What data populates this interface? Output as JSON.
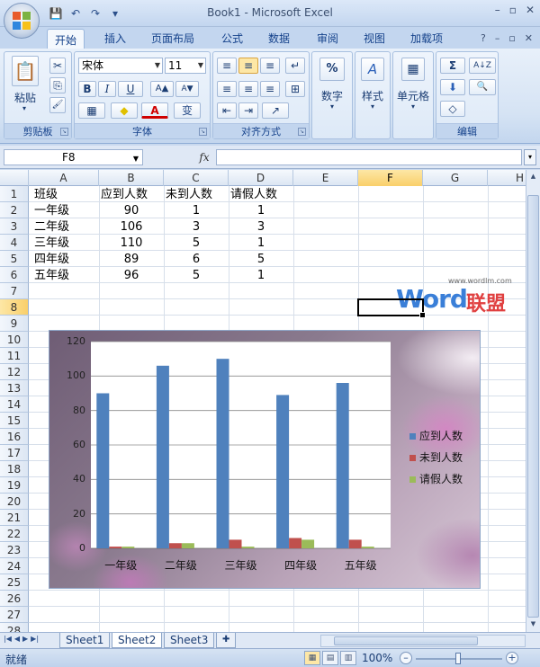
{
  "window": {
    "title": "Book1 - Microsoft Excel",
    "minimize": "–",
    "restore": "▫",
    "close": "✕"
  },
  "qat": {
    "save": "💾",
    "undo": "↶",
    "redo": "↷",
    "customize": "▾"
  },
  "tabs": [
    {
      "label": "开始",
      "active": true
    },
    {
      "label": "插入"
    },
    {
      "label": "页面布局"
    },
    {
      "label": "公式"
    },
    {
      "label": "数据"
    },
    {
      "label": "审阅"
    },
    {
      "label": "视图"
    },
    {
      "label": "加载项"
    }
  ],
  "tab_icons": {
    "help": "?",
    "min": "–",
    "restore": "▫",
    "close": "✕"
  },
  "ribbon": {
    "clipboard": {
      "label": "剪贴板",
      "paste": "粘贴",
      "cut": "✂",
      "copy": "⎘",
      "format_painter": "🖌"
    },
    "font": {
      "label": "字体",
      "name": "宋体",
      "size": "11",
      "bold": "B",
      "italic": "I",
      "underline": "U",
      "grow": "A▲",
      "shrink": "A▼",
      "border": "▦",
      "fill": "◆",
      "color": "A",
      "phonetic": "变"
    },
    "alignment": {
      "label": "对齐方式",
      "top": "≡",
      "middle": "≡",
      "bottom": "≡",
      "wrap": "↵",
      "left": "≡",
      "center": "≡",
      "right": "≡",
      "merge": "⊞",
      "dec_indent": "⇤",
      "inc_indent": "⇥",
      "orient": "↗"
    },
    "number": {
      "label": "数字",
      "icon": "%"
    },
    "styles": {
      "label": "样式",
      "icon": "A"
    },
    "cells": {
      "label": "单元格",
      "icon": "▦"
    },
    "editing": {
      "label": "编辑",
      "sum": "Σ",
      "fill": "⬇",
      "clear": "◇",
      "sort": "A↓Z",
      "find": "🔍"
    }
  },
  "formula_bar": {
    "name_box": "F8",
    "fx": "fx",
    "formula": ""
  },
  "columns": [
    "A",
    "B",
    "C",
    "D",
    "E",
    "F",
    "G",
    "H"
  ],
  "selected_column": "F",
  "rows": [
    "1",
    "2",
    "3",
    "4",
    "5",
    "6",
    "7",
    "8",
    "9",
    "10",
    "11",
    "12",
    "13",
    "14",
    "15",
    "16",
    "17",
    "18",
    "19",
    "20",
    "21",
    "22",
    "23",
    "24",
    "25",
    "26",
    "27",
    "28"
  ],
  "selected_row": "8",
  "sheet": {
    "header": [
      "班级",
      "应到人数",
      "未到人数",
      "请假人数"
    ],
    "data": [
      [
        "一年级",
        "90",
        "1",
        "1"
      ],
      [
        "二年级",
        "106",
        "3",
        "3"
      ],
      [
        "三年级",
        "110",
        "5",
        "1"
      ],
      [
        "四年级",
        "89",
        "6",
        "5"
      ],
      [
        "五年级",
        "96",
        "5",
        "1"
      ]
    ]
  },
  "watermark": {
    "word": "Word",
    "cn": "联盟",
    "url": "www.wordlm.com"
  },
  "chart_data": {
    "type": "bar",
    "categories": [
      "一年级",
      "二年级",
      "三年级",
      "四年级",
      "五年级"
    ],
    "series": [
      {
        "name": "应到人数",
        "values": [
          90,
          106,
          110,
          89,
          96
        ],
        "color": "#4f81bd"
      },
      {
        "name": "未到人数",
        "values": [
          1,
          3,
          5,
          6,
          5
        ],
        "color": "#c0504d"
      },
      {
        "name": "请假人数",
        "values": [
          1,
          3,
          1,
          5,
          1
        ],
        "color": "#9bbb59"
      }
    ],
    "ylim": [
      0,
      120
    ],
    "yticks": [
      "0",
      "20",
      "40",
      "60",
      "80",
      "100",
      "120"
    ],
    "grid": true,
    "legend": "right"
  },
  "sheet_tabs": [
    {
      "label": "Sheet1"
    },
    {
      "label": "Sheet2",
      "active": true
    },
    {
      "label": "Sheet3"
    }
  ],
  "status": {
    "text": "就绪",
    "zoom": "100%",
    "minus": "–",
    "plus": "+"
  }
}
